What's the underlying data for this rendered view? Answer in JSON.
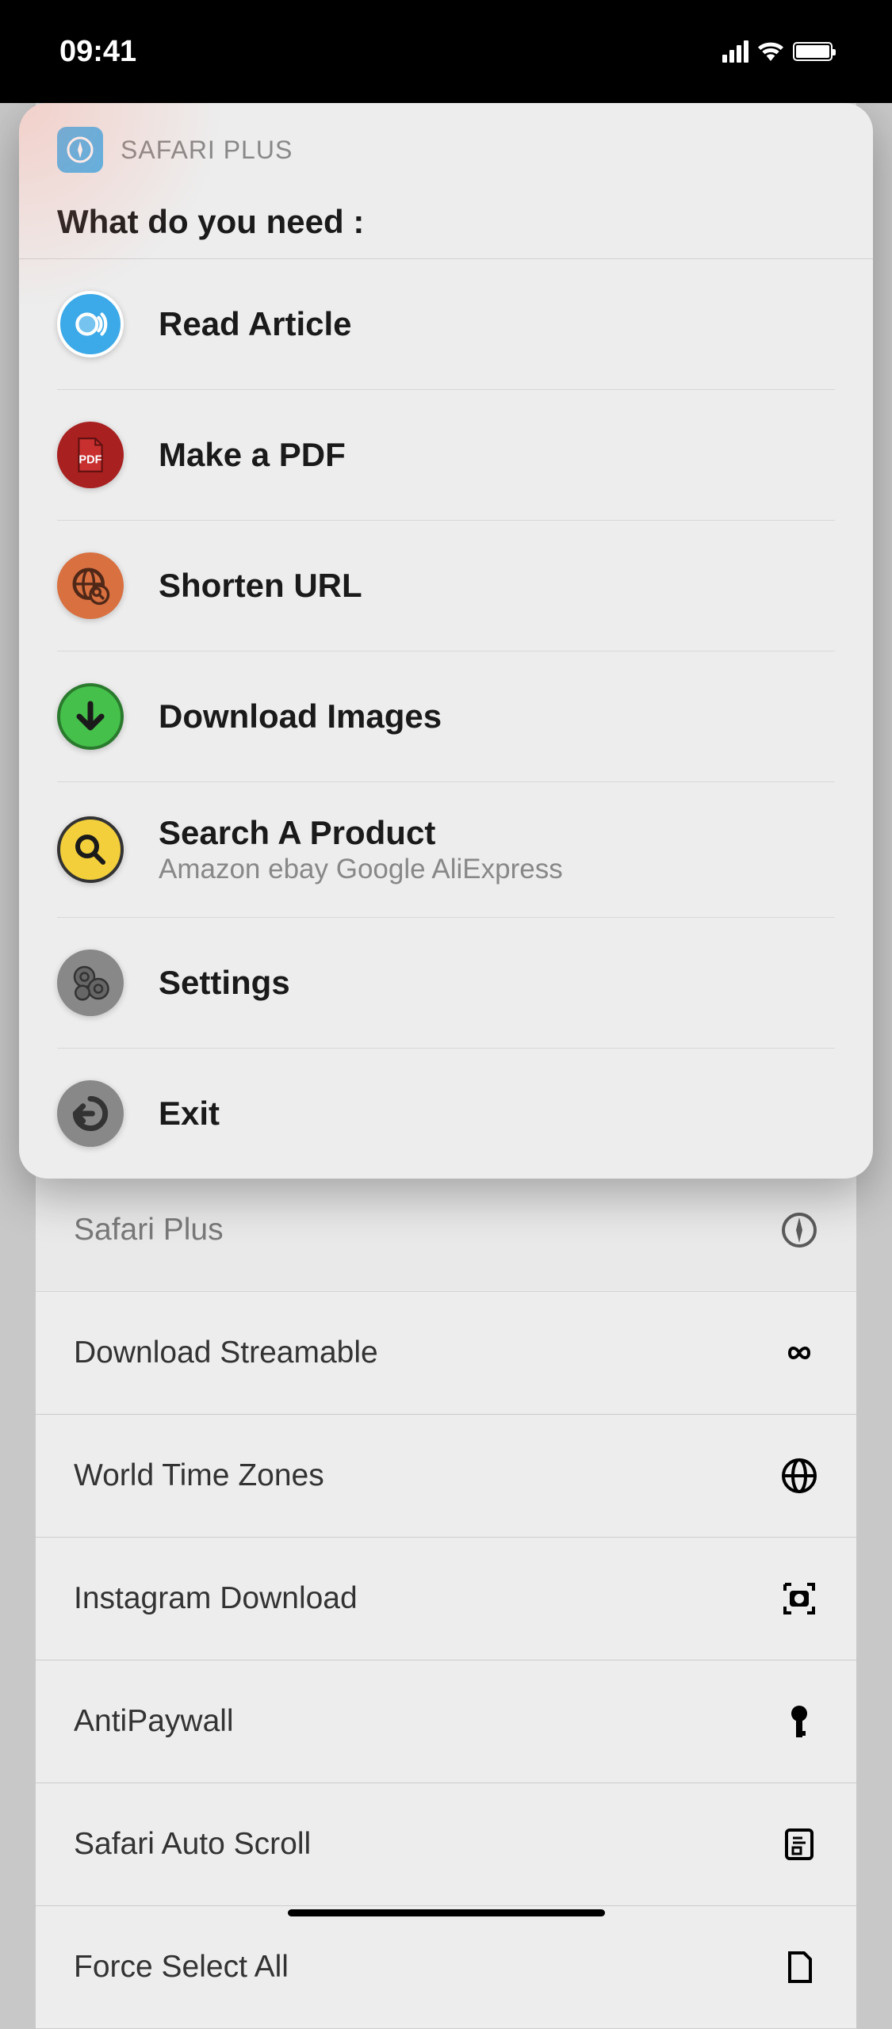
{
  "status": {
    "time": "09:41"
  },
  "card": {
    "app_name": "SAFARI PLUS",
    "prompt": "What do you need :",
    "items": [
      {
        "label": "Read Article",
        "icon": "read-icon"
      },
      {
        "label": "Make a PDF",
        "icon": "pdf-icon"
      },
      {
        "label": "Shorten URL",
        "icon": "shorten-icon"
      },
      {
        "label": "Download Images",
        "icon": "download-icon"
      },
      {
        "label": "Search A Product",
        "sublabel": "Amazon ebay Google AliExpress",
        "icon": "search-icon"
      },
      {
        "label": "Settings",
        "icon": "settings-icon"
      },
      {
        "label": "Exit",
        "icon": "exit-icon"
      }
    ]
  },
  "bg_list": {
    "items": [
      {
        "label": "Safari Plus",
        "icon": "compass-icon"
      },
      {
        "label": "Download Streamable",
        "icon": "infinity-icon"
      },
      {
        "label": "World Time Zones",
        "icon": "globe-icon"
      },
      {
        "label": "Instagram Download",
        "icon": "camera-icon"
      },
      {
        "label": "AntiPaywall",
        "icon": "key-icon"
      },
      {
        "label": "Safari Auto Scroll",
        "icon": "document-icon"
      },
      {
        "label": "Force Select All",
        "icon": "page-icon"
      }
    ]
  }
}
